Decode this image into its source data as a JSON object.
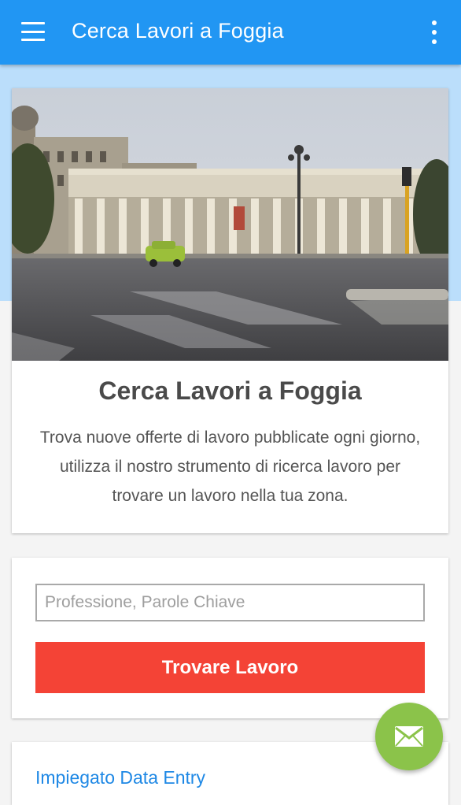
{
  "appbar": {
    "title": "Cerca Lavori a Foggia",
    "menu_icon": "hamburger-menu-icon",
    "more_icon": "more-vertical-icon",
    "color": "#2196f3"
  },
  "hero": {
    "image_alt": "Piazza Cavour, Foggia",
    "title": "Cerca Lavori a Foggia",
    "description": "Trova nuove offerte di lavoro pubblicate ogni giorno, utilizza il nostro strumento di ricerca lavoro per trovare un lavoro nella tua zona."
  },
  "search": {
    "placeholder": "Professione, Parole Chiave",
    "value": "",
    "button_label": "Trovare Lavoro",
    "button_color": "#f44336"
  },
  "jobs": [
    {
      "title": "Impiegato Data Entry"
    }
  ],
  "fab": {
    "icon": "envelope-icon",
    "color": "#8bc34a"
  }
}
